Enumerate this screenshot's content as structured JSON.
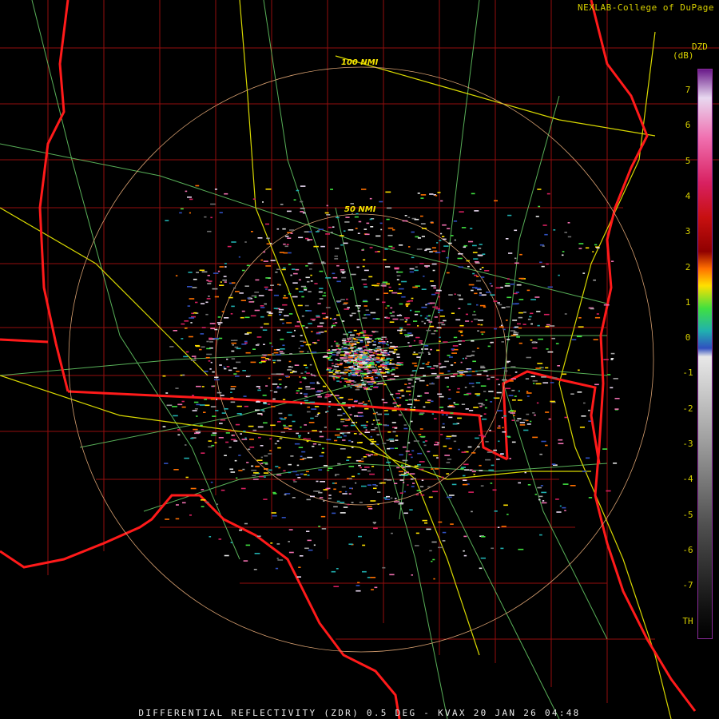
{
  "credit": "NEXLAB-College of DuPage",
  "footer": "DIFFERENTIAL REFLECTIVITY (ZDR) 0.5 DEG - KVAX 20 JAN 26 04:48",
  "colorbar": {
    "title": "DZD",
    "unit": "(dB)",
    "ticks": [
      "7",
      "6",
      "5",
      "4",
      "3",
      "2",
      "1",
      "0",
      "-1",
      "-2",
      "-3",
      "-4",
      "-5",
      "-6",
      "-7",
      "TH"
    ],
    "stops": [
      {
        "value": 7.5,
        "color": "#6a1a8a"
      },
      {
        "value": 6.5,
        "color": "#e8d8f0"
      },
      {
        "value": 5.5,
        "color": "#f070b0"
      },
      {
        "value": 4.8,
        "color": "#d82060"
      },
      {
        "value": 4.0,
        "color": "#c81010"
      },
      {
        "value": 3.0,
        "color": "#b00000"
      },
      {
        "value": 2.4,
        "color": "#ff7000"
      },
      {
        "value": 1.8,
        "color": "#ffe000"
      },
      {
        "value": 1.2,
        "color": "#40e040"
      },
      {
        "value": 0.6,
        "color": "#20b0b0"
      },
      {
        "value": 0.0,
        "color": "#3050c0"
      },
      {
        "value": -0.5,
        "color": "#e0e0e0"
      },
      {
        "value": -3.0,
        "color": "#a0a0a0"
      },
      {
        "value": -5.0,
        "color": "#606060"
      },
      {
        "value": -7.5,
        "color": "#202020"
      }
    ]
  },
  "range_rings": {
    "radar_site": "KVAX",
    "inner_label": "50 NMI",
    "outer_label": "100 NMI"
  },
  "map_colors": {
    "state_borders": "#ff1010",
    "county_borders": "#b01010",
    "highways": "#d8d800",
    "roads": "#70e070",
    "rings": "#d8a070"
  }
}
